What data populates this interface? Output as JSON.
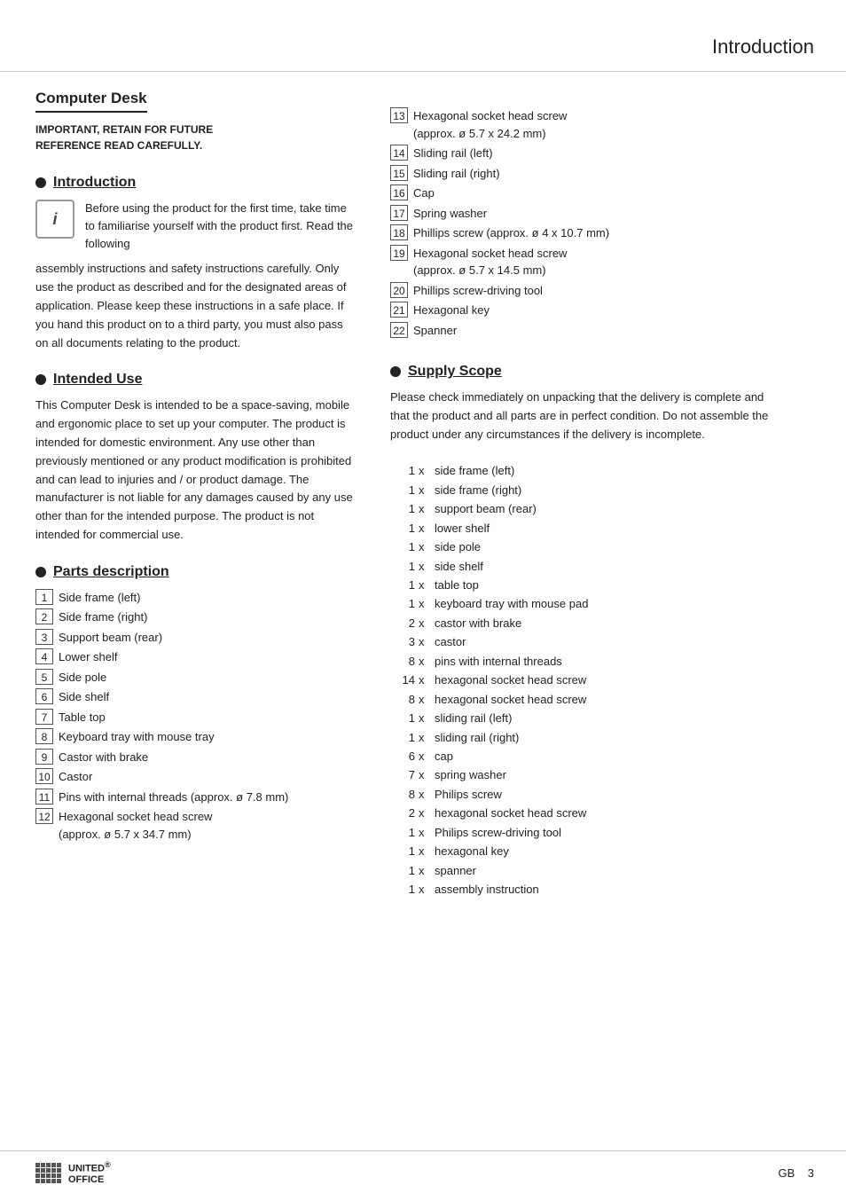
{
  "header": {
    "title": "Introduction"
  },
  "left_col": {
    "computer_desk": {
      "title": "Computer Desk",
      "important": "IMPORTANT, RETAIN FOR FUTURE\nREFERENCE READ CAREFULLY."
    },
    "introduction": {
      "heading": "Introduction",
      "info_box_text": "i",
      "intro_paragraph1": "Before using the product for the first time, take time to familiarise yourself with the product first. Read the following assembly instructions and safety instructions carefully. Only use the product as described and for the designated areas of application. Please keep these instructions in a safe place. If you hand this product on to a third party, you must also pass on all documents relating to the product."
    },
    "intended_use": {
      "heading": "Intended Use",
      "body": "This Computer Desk is intended to be a space-saving, mobile and ergonomic place to set up your computer. The product is intended for domestic environment. Any use other than previously mentioned or any product modification is prohibited and can lead to injuries and / or product damage. The manufacturer is not liable for any damages caused by any use other than for the intended purpose. The product is not intended for commercial use."
    },
    "parts_description": {
      "heading": "Parts description",
      "parts": [
        {
          "num": "1",
          "label": "Side frame (left)"
        },
        {
          "num": "2",
          "label": "Side frame (right)"
        },
        {
          "num": "3",
          "label": "Support beam (rear)"
        },
        {
          "num": "4",
          "label": "Lower shelf"
        },
        {
          "num": "5",
          "label": "Side pole"
        },
        {
          "num": "6",
          "label": "Side shelf"
        },
        {
          "num": "7",
          "label": "Table top"
        },
        {
          "num": "8",
          "label": "Keyboard tray with mouse tray"
        },
        {
          "num": "9",
          "label": "Castor with brake"
        },
        {
          "num": "10",
          "label": "Castor"
        },
        {
          "num": "11",
          "label": "Pins with internal threads (approx. ø 7.8 mm)"
        },
        {
          "num": "12",
          "label": "Hexagonal socket head screw\n(approx. ø 5.7 x 34.7 mm)"
        }
      ]
    }
  },
  "right_col": {
    "parts_continued": [
      {
        "num": "13",
        "label": "Hexagonal socket head screw\n(approx. ø 5.7 x 24.2 mm)"
      },
      {
        "num": "14",
        "label": "Sliding rail (left)"
      },
      {
        "num": "15",
        "label": "Sliding rail (right)"
      },
      {
        "num": "16",
        "label": "Cap"
      },
      {
        "num": "17",
        "label": "Spring washer"
      },
      {
        "num": "18",
        "label": "Phillips screw (approx. ø 4 x 10.7 mm)"
      },
      {
        "num": "19",
        "label": "Hexagonal socket head screw\n(approx. ø 5.7 x 14.5 mm)"
      },
      {
        "num": "20",
        "label": "Phillips screw-driving tool"
      },
      {
        "num": "21",
        "label": "Hexagonal key"
      },
      {
        "num": "22",
        "label": "Spanner"
      }
    ],
    "supply_scope": {
      "heading": "Supply Scope",
      "body": "Please check immediately on unpacking that the delivery is complete and that the product and all parts are in perfect condition. Do not assemble the product under any circumstances if the delivery is incomplete.",
      "items": [
        {
          "qty": "1",
          "x": "x",
          "label": "side frame (left)"
        },
        {
          "qty": "1",
          "x": "x",
          "label": "side frame (right)"
        },
        {
          "qty": "1",
          "x": "x",
          "label": "support beam (rear)"
        },
        {
          "qty": "1",
          "x": "x",
          "label": "lower shelf"
        },
        {
          "qty": "1",
          "x": "x",
          "label": "side pole"
        },
        {
          "qty": "1",
          "x": "x",
          "label": "side shelf"
        },
        {
          "qty": "1",
          "x": "x",
          "label": "table top"
        },
        {
          "qty": "1",
          "x": "x",
          "label": "keyboard tray with mouse pad"
        },
        {
          "qty": "2",
          "x": "x",
          "label": "castor with brake"
        },
        {
          "qty": "3",
          "x": "x",
          "label": "castor"
        },
        {
          "qty": "8",
          "x": "x",
          "label": "pins with internal threads"
        },
        {
          "qty": "14",
          "x": "x",
          "label": "hexagonal socket head screw"
        },
        {
          "qty": "8",
          "x": "x",
          "label": "hexagonal socket head screw"
        },
        {
          "qty": "1",
          "x": "x",
          "label": "sliding rail (left)"
        },
        {
          "qty": "1",
          "x": "x",
          "label": "sliding rail (right)"
        },
        {
          "qty": "6",
          "x": "x",
          "label": "cap"
        },
        {
          "qty": "7",
          "x": "x",
          "label": "spring washer"
        },
        {
          "qty": "8",
          "x": "x",
          "label": "Philips screw"
        },
        {
          "qty": "2",
          "x": "x",
          "label": "hexagonal socket head screw"
        },
        {
          "qty": "1",
          "x": "x",
          "label": "Philips screw-driving tool"
        },
        {
          "qty": "1",
          "x": "x",
          "label": "hexagonal key"
        },
        {
          "qty": "1",
          "x": "x",
          "label": "spanner"
        },
        {
          "qty": "1",
          "x": "x",
          "label": "assembly instruction"
        }
      ]
    }
  },
  "footer": {
    "logo_name": "UNITED\nOFFICE",
    "page_label": "GB",
    "page_num": "3"
  }
}
